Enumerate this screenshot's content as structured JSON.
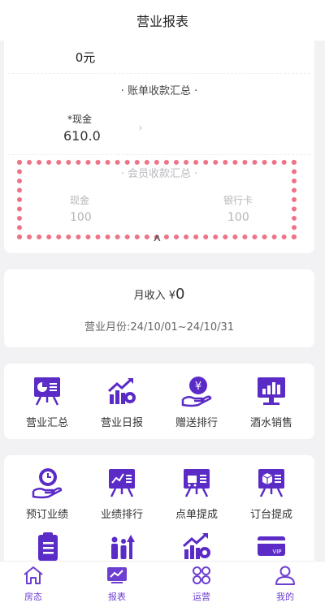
{
  "header": {
    "title": "营业报表"
  },
  "summary": {
    "zero_total": "0元",
    "bill_section_title": "·  账单收款汇总  ·",
    "cash_label": "*现金",
    "cash_value": "610.0",
    "member_section_title": "·  会员收款汇总  ·",
    "member_cash_label": "现金",
    "member_cash_value": "100",
    "member_card_label": "银行卡",
    "member_card_value": "100"
  },
  "monthly": {
    "income_label": "月收入 ¥",
    "income_value": "0",
    "range": "营业月份:24/10/01~24/10/31"
  },
  "grid1": [
    {
      "label": "营业汇总",
      "icon": "presentation-chart-icon"
    },
    {
      "label": "营业日报",
      "icon": "chart-gear-icon"
    },
    {
      "label": "赠送排行",
      "icon": "yen-hand-icon"
    },
    {
      "label": "酒水销售",
      "icon": "monitor-bar-icon"
    }
  ],
  "grid2": [
    {
      "label": "预订业绩",
      "icon": "clock-hand-icon"
    },
    {
      "label": "业绩排行",
      "icon": "trend-board-icon"
    },
    {
      "label": "点单提成",
      "icon": "cart-board-icon"
    },
    {
      "label": "订台提成",
      "icon": "box-board-icon"
    }
  ],
  "grid3_icons": [
    "clipboard-icon",
    "people-arrow-icon",
    "chart-gear-icon",
    "vip-card-icon"
  ],
  "tabs": [
    {
      "label": "房态",
      "icon": "home-icon"
    },
    {
      "label": "报表",
      "icon": "report-icon"
    },
    {
      "label": "运营",
      "icon": "apps-icon"
    },
    {
      "label": "我的",
      "icon": "user-icon"
    }
  ],
  "colors": {
    "accent": "#5a2bc7",
    "highlight_border": "#ee7386"
  }
}
